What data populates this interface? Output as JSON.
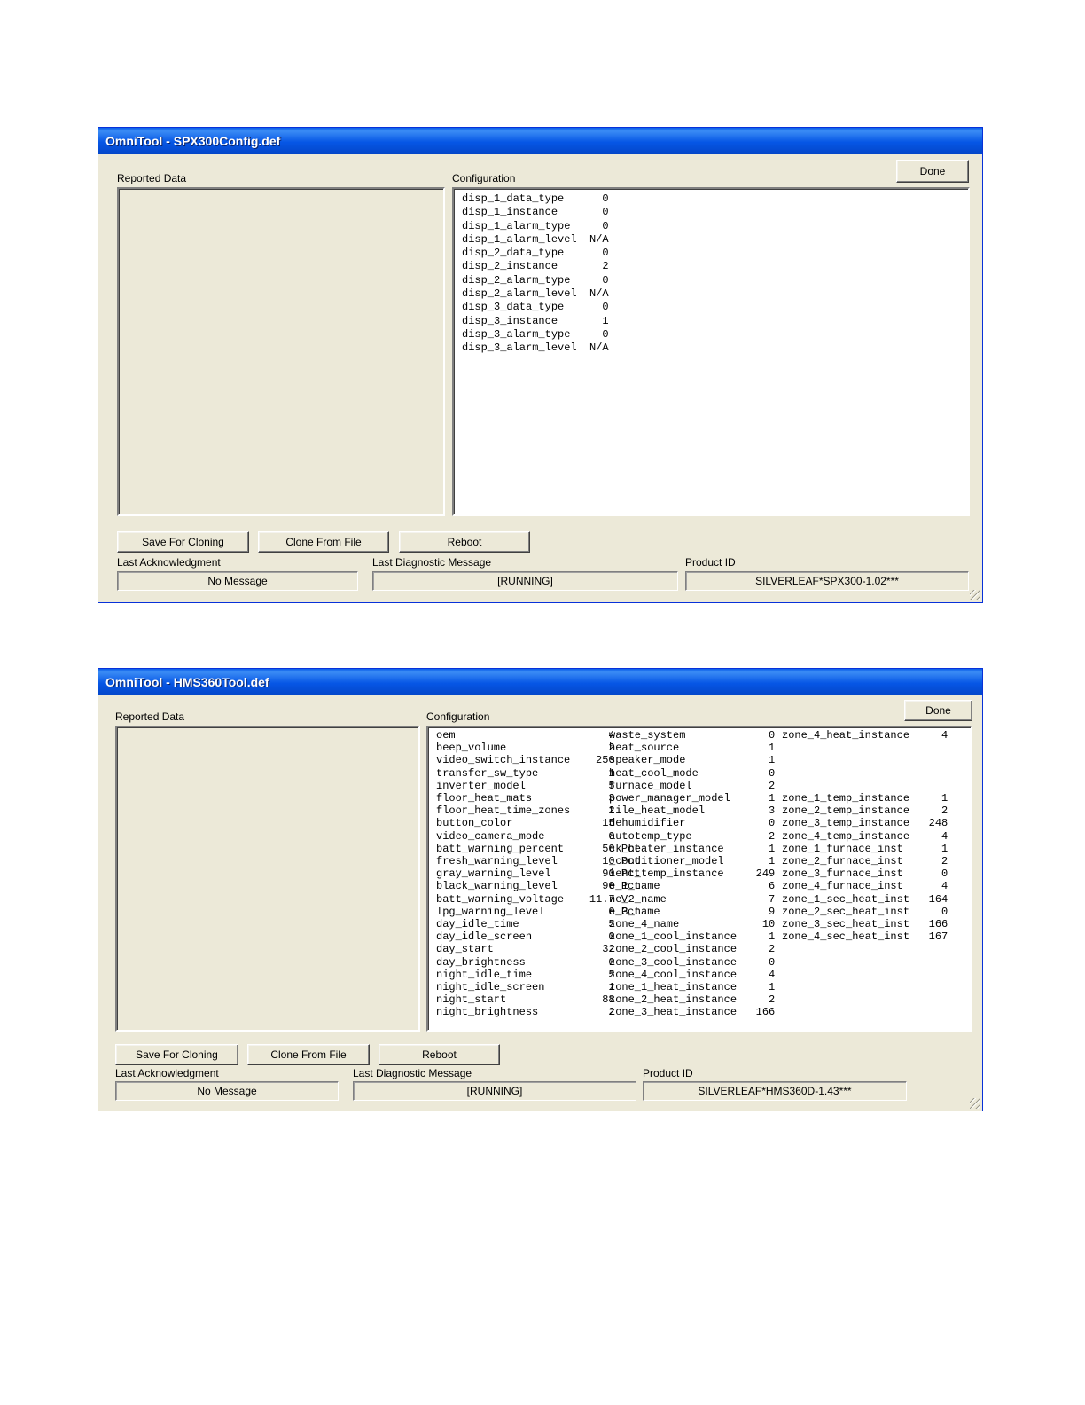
{
  "window1": {
    "title": "OmniTool - SPX300Config.def",
    "reported_data_label": "Reported Data",
    "configuration_label": "Configuration",
    "done_label": "Done",
    "config_lines": [
      "disp_1_data_type      0",
      "disp_1_instance       0",
      "disp_1_alarm_type     0",
      "disp_1_alarm_level  N/A",
      "disp_2_data_type      0",
      "disp_2_instance       2",
      "disp_2_alarm_type     0",
      "disp_2_alarm_level  N/A",
      "disp_3_data_type      0",
      "disp_3_instance       1",
      "disp_3_alarm_type     0",
      "disp_3_alarm_level  N/A"
    ],
    "save_label": "Save For Cloning",
    "clone_label": "Clone From File",
    "reboot_label": "Reboot",
    "last_ack_label": "Last Acknowledgment",
    "last_ack_value": "No Message",
    "last_diag_label": "Last Diagnostic Message",
    "last_diag_value": "[RUNNING]",
    "product_id_label": "Product ID",
    "product_id_value": "SILVERLEAF*SPX300-1.02***"
  },
  "window2": {
    "title": "OmniTool - HMS360Tool.def",
    "reported_data_label": "Reported Data",
    "configuration_label": "Configuration",
    "done_label": "Done",
    "config_col1": [
      "oem                        4",
      "beep_volume                2",
      "video_switch_instance    250",
      "transfer_sw_type           1",
      "inverter_model             5",
      "floor_heat_mats            3",
      "floor_heat_time_zones      2",
      "button_color              15",
      "video_camera_mode          0",
      "batt_warning_percent      50 Pct",
      "fresh_warning_level       10 Pct",
      "gray_warning_level        90 Pct",
      "black_warning_level       90 Pct",
      "batt_warning_voltage    11.7 V",
      "lpg_warning_level          0 Pct",
      "day_idle_time              5",
      "day_idle_screen            0",
      "day_start                 32",
      "day_brightness             0",
      "night_idle_time            5",
      "night_idle_screen          1",
      "night_start               88",
      "night_brightness           2"
    ],
    "config_col2": [
      "waste_system             0",
      "heat_source              1",
      "speaker_mode             1",
      "heat_cool_mode           0",
      "furnace_model            2",
      "power_manager_model      1",
      "tile_heat_model          3",
      "dehumidifier             0",
      "autotemp_type            2",
      "ck_heater_instance       1",
      "_conditioner_model       1",
      "ient_temp_instance     249",
      "e_1_name                 6",
      "ne_2_name                7",
      "e_3_name                 9",
      "zone_4_name             10",
      "zone_1_cool_instance     1",
      "zone_2_cool_instance     2",
      "zone_3_cool_instance     0",
      "zone_4_cool_instance     4",
      "zone_1_heat_instance     1",
      "zone_2_heat_instance     2",
      "zone_3_heat_instance   166"
    ],
    "config_col3": [
      "zone_4_heat_instance     4",
      "",
      "",
      "",
      "",
      "zone_1_temp_instance     1",
      "zone_2_temp_instance     2",
      "zone_3_temp_instance   248",
      "zone_4_temp_instance     4",
      "zone_1_furnace_inst      1",
      "zone_2_furnace_inst      2",
      "zone_3_furnace_inst      0",
      "zone_4_furnace_inst      4",
      "zone_1_sec_heat_inst   164",
      "zone_2_sec_heat_inst     0",
      "zone_3_sec_heat_inst   166",
      "zone_4_sec_heat_inst   167"
    ],
    "save_label": "Save For Cloning",
    "clone_label": "Clone From File",
    "reboot_label": "Reboot",
    "last_ack_label": "Last Acknowledgment",
    "last_ack_value": "No Message",
    "last_diag_label": "Last Diagnostic Message",
    "last_diag_value": "[RUNNING]",
    "product_id_label": "Product ID",
    "product_id_value": "SILVERLEAF*HMS360D-1.43***"
  }
}
